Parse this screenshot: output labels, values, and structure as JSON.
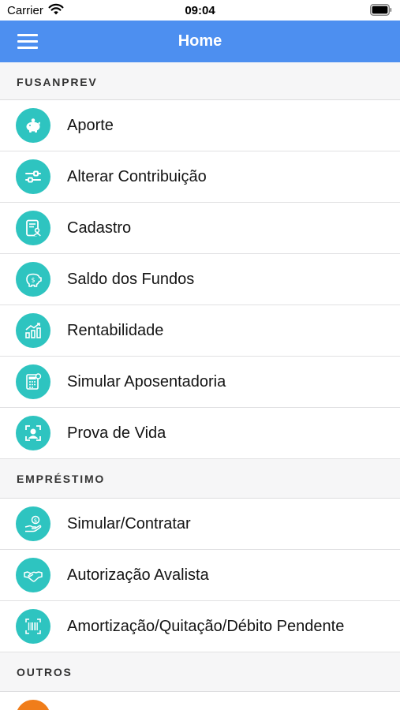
{
  "status_bar": {
    "carrier": "Carrier",
    "time": "09:04"
  },
  "nav": {
    "title": "Home"
  },
  "colors": {
    "nav_blue": "#4d8ff0",
    "icon_teal": "#2ec4c0",
    "icon_orange": "#f07d1a"
  },
  "sections": [
    {
      "title": "FUSANPREV",
      "items": [
        {
          "label": "Aporte",
          "icon": "piggy-bank-icon"
        },
        {
          "label": "Alterar Contribuição",
          "icon": "sliders-icon"
        },
        {
          "label": "Cadastro",
          "icon": "profile-document-icon"
        },
        {
          "label": "Saldo dos Fundos",
          "icon": "piggy-coin-icon"
        },
        {
          "label": "Rentabilidade",
          "icon": "growth-chart-icon"
        },
        {
          "label": "Simular Aposentadoria",
          "icon": "calculator-icon"
        },
        {
          "label": "Prova de Vida",
          "icon": "face-id-icon"
        }
      ]
    },
    {
      "title": "EMPRÉSTIMO",
      "items": [
        {
          "label": "Simular/Contratar",
          "icon": "hand-coin-icon"
        },
        {
          "label": "Autorização Avalista",
          "icon": "handshake-icon"
        },
        {
          "label": "Amortização/Quitação/Débito Pendente",
          "icon": "barcode-icon"
        }
      ]
    },
    {
      "title": "OUTROS",
      "items": [
        {
          "label": "",
          "icon": "orange-icon"
        }
      ]
    }
  ]
}
